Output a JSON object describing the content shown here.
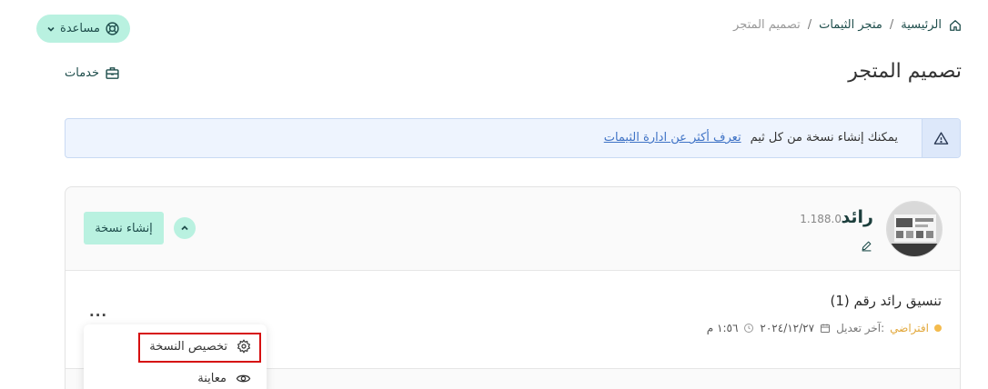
{
  "breadcrumb": {
    "home": "الرئيسية",
    "sep1": "/",
    "store": "متجر الثيمات",
    "sep2": "/",
    "current": "تصميم المتجر"
  },
  "help": {
    "label": "مساعدة"
  },
  "page": {
    "title": "تصميم المتجر"
  },
  "services": {
    "label": "خدمات"
  },
  "alert": {
    "message": "يمكنك إنشاء نسخة من كل ثيم",
    "link": "تعرف أكثر عن ادارة الثيمات"
  },
  "theme": {
    "name": "رائد",
    "version": "1.188.0",
    "create_copy_label": "إنشاء نسخة",
    "copy": {
      "title": "تنسيق رائد رقم (1)",
      "status": "افتراضي",
      "modified_label": "آخر تعديل:",
      "date": "٢٠٢٤/١٢/٢٧",
      "time": "١:٥٦ م",
      "more_label": "..."
    }
  },
  "dropdown": {
    "items": [
      {
        "label": "تخصيص النسخة",
        "icon": "gear-icon"
      },
      {
        "label": "معاينة",
        "icon": "eye-icon"
      }
    ]
  },
  "colors": {
    "accent": "#b9f1e0",
    "brand": "#1f4e4c",
    "default_badge": "#f4bb4d",
    "alert_bg": "#eef4fe",
    "highlight": "#d60f10"
  }
}
